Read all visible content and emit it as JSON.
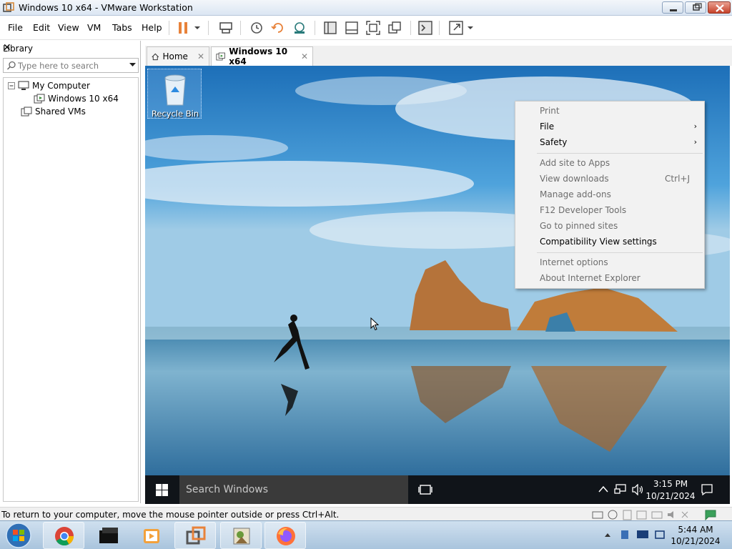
{
  "window": {
    "title": "Windows 10 x64 - VMware Workstation"
  },
  "menubar": {
    "file": "File",
    "edit": "Edit",
    "view": "View",
    "vm": "VM",
    "tabs": "Tabs",
    "help": "Help"
  },
  "library": {
    "title": "Library",
    "search_placeholder": "Type here to search",
    "tree": {
      "my_computer": "My Computer",
      "vm_item": "Windows 10 x64",
      "shared": "Shared VMs"
    }
  },
  "tabs": [
    {
      "label": "Home"
    },
    {
      "label": "Windows 10 x64"
    }
  ],
  "guest": {
    "desktop_icon": "Recycle Bin",
    "context_menu": [
      {
        "label": "Print",
        "enabled": false
      },
      {
        "label": "File",
        "enabled": true,
        "submenu": true
      },
      {
        "label": "Safety",
        "enabled": true,
        "submenu": true
      },
      {
        "label": "Add site to Apps",
        "enabled": false
      },
      {
        "label": "View downloads",
        "enabled": false,
        "shortcut": "Ctrl+J"
      },
      {
        "label": "Manage add-ons",
        "enabled": false
      },
      {
        "label": "F12 Developer Tools",
        "enabled": false
      },
      {
        "label": "Go to pinned sites",
        "enabled": false
      },
      {
        "label": "Compatibility View settings",
        "enabled": true
      },
      {
        "label": "Internet options",
        "enabled": false
      },
      {
        "label": "About Internet Explorer",
        "enabled": false
      }
    ],
    "taskbar": {
      "search_placeholder": "Search Windows",
      "time": "3:15 PM",
      "date": "10/21/2024"
    }
  },
  "statusbar": {
    "message": "To return to your computer, move the mouse pointer outside or press Ctrl+Alt."
  },
  "host_taskbar": {
    "time": "5:44 AM",
    "date": "10/21/2024"
  },
  "colors": {
    "accent": "#2b6cb0",
    "menu_bg": "#f2f2f2",
    "disabled_text": "#6d6d6d",
    "vm_tab_icon": "#3a8f3a"
  },
  "icons": [
    "app-icon",
    "minimize-icon",
    "maximize-icon",
    "close-icon",
    "suspend-icon",
    "dropdown-icon",
    "send-keys-icon",
    "snapshot-icon",
    "revert-icon",
    "snapshot-manager-icon",
    "show-library-icon",
    "thumbnail-icon",
    "full-screen-icon",
    "unity-icon",
    "console-icon",
    "stretch-icon",
    "search-icon",
    "computer-icon",
    "vm-icon",
    "shared-vms-icon",
    "home-icon",
    "recycle-bin-icon",
    "start-icon",
    "task-view-icon",
    "chevron-up-icon",
    "network-icon",
    "volume-icon",
    "notifications-icon"
  ]
}
